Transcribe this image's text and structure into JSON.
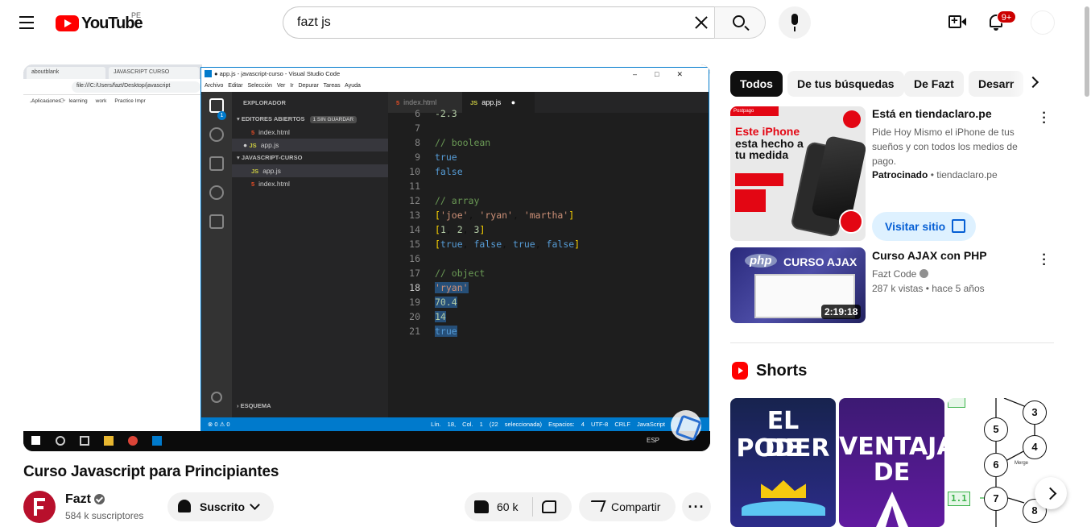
{
  "masthead": {
    "logo_text": "YouTube",
    "country_code": "PE",
    "search_value": "fazt js",
    "notification_count": "9+"
  },
  "player": {
    "chrome": {
      "tab1": "aboutblank",
      "tab2": "JAVASCRIPT CURSO",
      "url": "file:///C:/Users/fazt/Desktop/javascript",
      "bookmarks": [
        "Aplicaciones",
        "learning",
        "work",
        "Practice Impr"
      ]
    },
    "vscode": {
      "window_title": "● app.js - javascript-curso - Visual Studio Code",
      "menu": "Archivo Editar Selección Ver Ir Depurar Tareas Ayuda",
      "explorer_title": "EXPLORADOR",
      "open_editors": "EDITORES ABIERTOS",
      "unsaved": "1 SIN GUARDAR",
      "project": "JAVASCRIPT-CURSO",
      "outline": "ESQUEMA",
      "files": {
        "open_html": "index.html",
        "open_js": "app.js",
        "proj_js": "app.js",
        "proj_html": "index.html"
      },
      "tabs": [
        "index.html",
        "app.js"
      ],
      "activity_badge": "1",
      "code_lines": [
        {
          "n": "6",
          "t": "-2.3",
          "k": "num"
        },
        {
          "n": "7",
          "t": "",
          "k": "def"
        },
        {
          "n": "8",
          "t": "// boolean",
          "k": "com"
        },
        {
          "n": "9",
          "t": "true",
          "k": "kw"
        },
        {
          "n": "10",
          "t": "false",
          "k": "kw"
        },
        {
          "n": "11",
          "t": "",
          "k": "def"
        },
        {
          "n": "12",
          "t": "// array",
          "k": "com"
        },
        {
          "n": "13",
          "t": "['joe', 'ryan', 'martha']",
          "k": "arr1"
        },
        {
          "n": "14",
          "t": "[1, 2, 3]",
          "k": "arr2"
        },
        {
          "n": "15",
          "t": "[true, false, true, false]",
          "k": "arr3"
        },
        {
          "n": "16",
          "t": "",
          "k": "def"
        },
        {
          "n": "17",
          "t": "// object",
          "k": "com"
        },
        {
          "n": "18",
          "t": "'ryan'",
          "k": "str"
        },
        {
          "n": "19",
          "t": "70.4",
          "k": "num"
        },
        {
          "n": "20",
          "t": "14",
          "k": "num"
        },
        {
          "n": "21",
          "t": "true",
          "k": "kw"
        }
      ],
      "status_left": "⊗ 0 ⚠ 0",
      "status_right": "Lín. 18, Col. 1 (22 seleccionada) Espacios: 4 UTF-8 CRLF JavaScript"
    },
    "taskbar_lang": "ESP"
  },
  "video": {
    "title": "Curso Javascript para Principiantes",
    "channel": "Fazt",
    "subscribers": "584 k suscriptores",
    "subscribe_label": "Suscrito",
    "likes": "60 k",
    "share_label": "Compartir"
  },
  "chips": [
    "Todos",
    "De tus búsquedas",
    "De Fazt",
    "Desarr"
  ],
  "ad": {
    "title": "Está en tiendaclaro.pe",
    "description": "Pide Hoy Mismo el iPhone de tus sueños y con todos los medios de pago.",
    "sponsor_label": "Patrocinado",
    "sponsor_domain": "tiendaclaro.pe",
    "visit_label": "Visitar sitio",
    "thumb_top": "Postpago",
    "thumb_headline_1": "Este iPhone",
    "thumb_headline_2": "esta hecho a",
    "thumb_headline_3": "tu medida"
  },
  "related": [
    {
      "title": "Curso AJAX con PHP",
      "channel": "Fazt Code",
      "views": "287 k vistas",
      "age": "hace 5 años",
      "duration": "2:19:18",
      "thumb_php": "php",
      "thumb_text": "CURSO AJAX"
    }
  ],
  "shorts": {
    "heading": "Shorts",
    "items": [
      {
        "line1": "EL PODER",
        "line2": "DE"
      },
      {
        "line1": "VENTAJAS",
        "line2": "DE"
      },
      {
        "nodes": [
          "3",
          "5",
          "4",
          "6",
          "7",
          "8"
        ],
        "tag": "1.1",
        "merge": "Merge"
      }
    ]
  },
  "colors": {
    "youtube_red": "#ff0000",
    "vscode_blue": "#007acc",
    "link_blue": "#065fd4"
  }
}
